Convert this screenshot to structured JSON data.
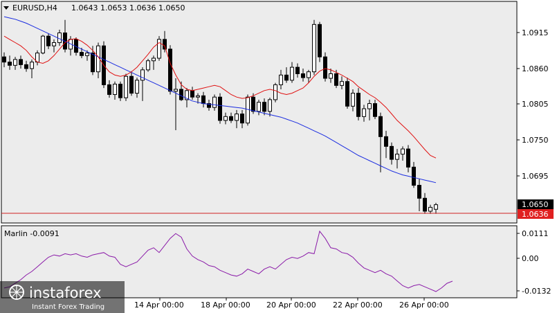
{
  "main": {
    "symbol_label": "EURUSD,H4",
    "ohlc_label": "1.0643 1.0653 1.0636 1.0650",
    "price_ticks": [
      "1.0915",
      "1.0860",
      "1.0805",
      "1.0750",
      "1.0695"
    ],
    "current_price": "1.0650",
    "low_price": "1.0636"
  },
  "oscillator": {
    "label": "Marlin -0.0091",
    "ticks": [
      "0.0111",
      "0.00",
      "-0.0132"
    ]
  },
  "time_axis": {
    "labels": [
      "14 Apr 00:00",
      "18 Apr 00:00",
      "20 Apr 00:00",
      "22 Apr 00:00",
      "26 Apr 00:00"
    ]
  },
  "watermark": {
    "brand": "instaforex",
    "tagline": "Instant Forex Trading"
  },
  "colors": {
    "background": "#ececec",
    "fast_ma": "#e01010",
    "slow_ma": "#1a2ce0",
    "oscillator": "#8a1aa8",
    "price_line": "#d02020",
    "low_tag": "#e02020"
  },
  "chart_data": {
    "type": "candlestick",
    "symbol": "EURUSD",
    "timeframe": "H4",
    "ylim": [
      1.0636,
      1.0945
    ],
    "candles": [
      [
        1.0878,
        1.0885,
        1.0862,
        1.087
      ],
      [
        1.087,
        1.088,
        1.0858,
        1.0865
      ],
      [
        1.0865,
        1.0878,
        1.0858,
        1.0874
      ],
      [
        1.0874,
        1.088,
        1.086,
        1.0866
      ],
      [
        1.0866,
        1.0872,
        1.0855,
        1.086
      ],
      [
        1.086,
        1.0874,
        1.0845,
        1.087
      ],
      [
        1.087,
        1.0888,
        1.0865,
        1.0884
      ],
      [
        1.0884,
        1.0912,
        1.0882,
        1.091
      ],
      [
        1.091,
        1.0914,
        1.089,
        1.0895
      ],
      [
        1.0895,
        1.0905,
        1.0885,
        1.09
      ],
      [
        1.09,
        1.092,
        1.0895,
        1.0915
      ],
      [
        1.0915,
        1.0935,
        1.0885,
        1.089
      ],
      [
        1.089,
        1.091,
        1.088,
        1.0905
      ],
      [
        1.0905,
        1.0908,
        1.088,
        1.0885
      ],
      [
        1.0885,
        1.0892,
        1.0876,
        1.088
      ],
      [
        1.088,
        1.0888,
        1.0872,
        1.0884
      ],
      [
        1.0884,
        1.0895,
        1.085,
        1.0855
      ],
      [
        1.0855,
        1.09,
        1.0845,
        1.0895
      ],
      [
        1.0895,
        1.0902,
        1.083,
        1.0835
      ],
      [
        1.0835,
        1.0842,
        1.0815,
        1.082
      ],
      [
        1.082,
        1.084,
        1.0812,
        1.0836
      ],
      [
        1.0836,
        1.084,
        1.081,
        1.0815
      ],
      [
        1.0815,
        1.0852,
        1.081,
        1.0848
      ],
      [
        1.0848,
        1.0856,
        1.0818,
        1.0822
      ],
      [
        1.0822,
        1.0846,
        1.0815,
        1.0842
      ],
      [
        1.0842,
        1.0862,
        1.081,
        1.0858
      ],
      [
        1.0858,
        1.0875,
        1.0855,
        1.0872
      ],
      [
        1.0872,
        1.088,
        1.0858,
        1.0876
      ],
      [
        1.0876,
        1.091,
        1.0872,
        1.0905
      ],
      [
        1.0905,
        1.0918,
        1.0885,
        1.089
      ],
      [
        1.089,
        1.0896,
        1.082,
        1.0825
      ],
      [
        1.0825,
        1.0845,
        1.0765,
        1.0828
      ],
      [
        1.0828,
        1.084,
        1.081,
        1.0812
      ],
      [
        1.0812,
        1.083,
        1.08,
        1.0826
      ],
      [
        1.0826,
        1.0832,
        1.0812,
        1.0816
      ],
      [
        1.0816,
        1.0822,
        1.0806,
        1.0818
      ],
      [
        1.0818,
        1.0824,
        1.08,
        1.0806
      ],
      [
        1.0806,
        1.0812,
        1.0795,
        1.08
      ],
      [
        1.08,
        1.082,
        1.0795,
        1.0816
      ],
      [
        1.0816,
        1.0822,
        1.0775,
        1.078
      ],
      [
        1.078,
        1.0792,
        1.0774,
        1.0786
      ],
      [
        1.0786,
        1.0792,
        1.0776,
        1.078
      ],
      [
        1.078,
        1.0796,
        1.0768,
        1.079
      ],
      [
        1.079,
        1.0796,
        1.0768,
        1.0776
      ],
      [
        1.0776,
        1.082,
        1.0772,
        1.0816
      ],
      [
        1.0816,
        1.0822,
        1.079,
        1.0794
      ],
      [
        1.0794,
        1.0812,
        1.0788,
        1.0808
      ],
      [
        1.0808,
        1.0814,
        1.0788,
        1.0794
      ],
      [
        1.0794,
        1.0815,
        1.0786,
        1.0812
      ],
      [
        1.0812,
        1.0838,
        1.0808,
        1.0835
      ],
      [
        1.0835,
        1.0858,
        1.0828,
        1.085
      ],
      [
        1.085,
        1.0862,
        1.0838,
        1.0842
      ],
      [
        1.0842,
        1.087,
        1.0838,
        1.0862
      ],
      [
        1.0862,
        1.0868,
        1.0846,
        1.0852
      ],
      [
        1.0852,
        1.086,
        1.084,
        1.0846
      ],
      [
        1.0846,
        1.0858,
        1.0838,
        1.0855
      ],
      [
        1.0855,
        1.0935,
        1.085,
        1.0928
      ],
      [
        1.0928,
        1.0932,
        1.087,
        1.0878
      ],
      [
        1.0878,
        1.0885,
        1.084,
        1.0845
      ],
      [
        1.0845,
        1.086,
        1.0838,
        1.0852
      ],
      [
        1.0852,
        1.0858,
        1.083,
        1.0834
      ],
      [
        1.0834,
        1.0848,
        1.0828,
        1.084
      ],
      [
        1.084,
        1.0846,
        1.0798,
        1.0802
      ],
      [
        1.0802,
        1.0828,
        1.0794,
        1.0822
      ],
      [
        1.0822,
        1.083,
        1.078,
        1.0786
      ],
      [
        1.0786,
        1.0804,
        1.0778,
        1.0798
      ],
      [
        1.0798,
        1.0812,
        1.078,
        1.0806
      ],
      [
        1.0806,
        1.0812,
        1.0782,
        1.0786
      ],
      [
        1.0786,
        1.0792,
        1.07,
        1.0755
      ],
      [
        1.0755,
        1.0764,
        1.0722,
        1.074
      ],
      [
        1.074,
        1.0746,
        1.0712,
        1.072
      ],
      [
        1.072,
        1.0736,
        1.0706,
        1.0728
      ],
      [
        1.0728,
        1.074,
        1.0718,
        1.0736
      ],
      [
        1.0736,
        1.0742,
        1.07,
        1.0708
      ],
      [
        1.0708,
        1.0716,
        1.0676,
        1.068
      ],
      [
        1.068,
        1.069,
        1.064,
        1.066
      ],
      [
        1.066,
        1.0668,
        1.0636,
        1.064
      ],
      [
        1.064,
        1.065,
        1.0636,
        1.0646
      ],
      [
        1.0643,
        1.0653,
        1.0636,
        1.065
      ]
    ],
    "fast_ma": [
      1.091,
      1.0905,
      1.09,
      1.0895,
      1.0888,
      1.0878,
      1.087,
      1.0868,
      1.0872,
      1.088,
      1.089,
      1.09,
      1.0905,
      1.0906,
      1.0902,
      1.0896,
      1.0888,
      1.0878,
      1.0865,
      1.0855,
      1.085,
      1.0848,
      1.085,
      1.0855,
      1.0862,
      1.0872,
      1.0882,
      1.0893,
      1.09,
      1.0895,
      1.0868,
      1.085,
      1.0835,
      1.0828,
      1.0826,
      1.0828,
      1.083,
      1.0832,
      1.0834,
      1.0832,
      1.0826,
      1.082,
      1.0816,
      1.0814,
      1.0815,
      1.0818,
      1.0822,
      1.0826,
      1.0828,
      1.0826,
      1.0822,
      1.082,
      1.0822,
      1.0826,
      1.083,
      1.0838,
      1.0848,
      1.0856,
      1.086,
      1.0858,
      1.0854,
      1.085,
      1.0845,
      1.084,
      1.0832,
      1.0826,
      1.082,
      1.0815,
      1.0808,
      1.08,
      1.079,
      1.078,
      1.0772,
      1.0764,
      1.0755,
      1.0745,
      1.0735,
      1.0726,
      1.0722
    ],
    "slow_ma": [
      1.094,
      1.0938,
      1.0936,
      1.0933,
      1.093,
      1.0926,
      1.0922,
      1.0918,
      1.0914,
      1.091,
      1.0906,
      1.0902,
      1.0898,
      1.0894,
      1.089,
      1.0886,
      1.0882,
      1.0878,
      1.0874,
      1.087,
      1.0866,
      1.0862,
      1.0858,
      1.0854,
      1.085,
      1.0846,
      1.0842,
      1.0838,
      1.0834,
      1.083,
      1.0826,
      1.0822,
      1.0818,
      1.0814,
      1.081,
      1.0808,
      1.0806,
      1.0805,
      1.0804,
      1.0803,
      1.0802,
      1.0801,
      1.08,
      1.0799,
      1.0797,
      1.0795,
      1.0793,
      1.0791,
      1.0789,
      1.0787,
      1.0785,
      1.0782,
      1.0779,
      1.0776,
      1.0772,
      1.0768,
      1.0764,
      1.076,
      1.0756,
      1.0751,
      1.0746,
      1.0741,
      1.0736,
      1.0731,
      1.0726,
      1.0722,
      1.0718,
      1.0714,
      1.071,
      1.0706,
      1.0702,
      1.0699,
      1.0696,
      1.0694,
      1.0692,
      1.069,
      1.0688,
      1.0686,
      1.0684
    ],
    "marlin": [
      -0.012,
      -0.0115,
      -0.01,
      -0.0085,
      -0.0065,
      -0.005,
      -0.003,
      -0.001,
      0.001,
      0.002,
      0.0015,
      0.0025,
      0.002,
      0.0025,
      0.0015,
      0.001,
      0.002,
      0.0025,
      0.003,
      0.0015,
      0.001,
      -0.002,
      -0.003,
      -0.002,
      -0.001,
      0.0015,
      0.004,
      0.005,
      0.003,
      0.006,
      0.009,
      0.011,
      0.0095,
      0.0045,
      0.0015,
      0.0,
      -0.001,
      -0.0025,
      -0.003,
      -0.0045,
      -0.0055,
      -0.0065,
      -0.007,
      -0.006,
      -0.004,
      -0.005,
      -0.006,
      -0.004,
      -0.003,
      -0.004,
      -0.002,
      0.0,
      0.001,
      0.0005,
      0.0015,
      0.003,
      0.0025,
      0.012,
      0.009,
      0.005,
      0.0045,
      0.003,
      0.0025,
      0.001,
      -0.0015,
      -0.0035,
      -0.0045,
      -0.0055,
      -0.0045,
      -0.006,
      -0.007,
      -0.009,
      -0.011,
      -0.012,
      -0.011,
      -0.0105,
      -0.0115,
      -0.0125,
      -0.0135,
      -0.012,
      -0.01,
      -0.0091
    ],
    "marlin_ylim": [
      -0.0145,
      0.0125
    ]
  }
}
